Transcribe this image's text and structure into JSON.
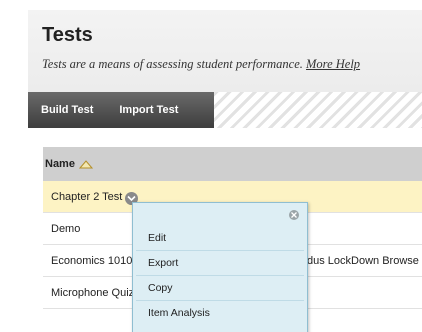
{
  "header": {
    "title": "Tests",
    "description": "Tests are a means of assessing student performance.",
    "help_link": "More Help"
  },
  "actionbar": {
    "build_label": "Build Test",
    "import_label": "Import Test"
  },
  "table": {
    "column_name": "Name",
    "rows": [
      {
        "name": "Chapter 2 Test"
      },
      {
        "name": "Demo"
      },
      {
        "name": "Economics 1010",
        "extra": "dus LockDown Browse"
      },
      {
        "name": "Microphone Quiz"
      }
    ]
  },
  "context_menu": {
    "items": [
      "Edit",
      "Export",
      "Copy",
      "Item Analysis"
    ]
  },
  "colors": {
    "highlight_row": "#fdf3c4",
    "menu_bg": "#ddeef4",
    "actionbar_dark": "#4a4a4a"
  }
}
